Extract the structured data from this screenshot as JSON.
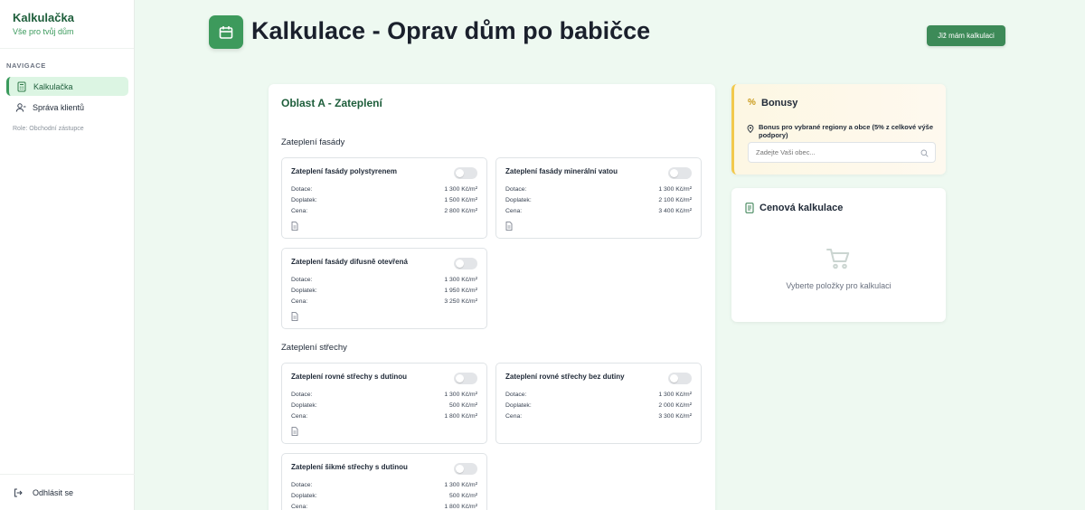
{
  "brand": {
    "title": "Kalkulačka",
    "subtitle": "Vše pro tvůj dům"
  },
  "nav": {
    "heading": "NAVIGACE",
    "items": [
      {
        "label": "Kalkulačka",
        "icon": "calculator-icon",
        "active": true
      },
      {
        "label": "Správa klientů",
        "icon": "user-icon",
        "active": false
      }
    ],
    "role": "Role: Obchodní zástupce",
    "logout": "Odhlásit se"
  },
  "header": {
    "title": "Kalkulace - Oprav dům po babičce",
    "icon": "calendar-icon",
    "button": "Již mám kalkulaci"
  },
  "area": {
    "title": "Oblast A - Zateplení",
    "sections": [
      {
        "title": "Zateplení fasády",
        "items": [
          {
            "name": "Zateplení fasády polystyrenem",
            "dotace": "1 300 Kč/m²",
            "doplatek": "1 500 Kč/m²",
            "cena": "2 800 Kč/m²"
          },
          {
            "name": "Zateplení fasády minerální vatou",
            "dotace": "1 300 Kč/m²",
            "doplatek": "2 100 Kč/m²",
            "cena": "3 400 Kč/m²"
          },
          {
            "name": "Zateplení fasády difusně otevřená",
            "dotace": "1 300 Kč/m²",
            "doplatek": "1 950 Kč/m²",
            "cena": "3 250 Kč/m²"
          }
        ]
      },
      {
        "title": "Zateplení střechy",
        "items": [
          {
            "name": "Zateplení rovné střechy s dutinou",
            "dotace": "1 300 Kč/m²",
            "doplatek": "500 Kč/m²",
            "cena": "1 800 Kč/m²"
          },
          {
            "name": "Zateplení rovné střechy bez dutiny",
            "dotace": "1 300 Kč/m²",
            "doplatek": "2 000 Kč/m²",
            "cena": "3 300 Kč/m²"
          },
          {
            "name": "Zateplení šikmé střechy s dutinou",
            "dotace": "1 300 Kč/m²",
            "doplatek": "500 Kč/m²",
            "cena": "1 800 Kč/m²"
          }
        ]
      }
    ],
    "labels": {
      "dotace": "Dotace:",
      "doplatek": "Doplatek:",
      "cena": "Cena:"
    }
  },
  "bonus": {
    "symbol": "%",
    "title": "Bonusy",
    "note": "Bonus pro vybrané regiony a obce (5% z celkové výše podpory)",
    "search_placeholder": "Zadejte Vaši obec...",
    "search_value": ""
  },
  "pricing": {
    "title": "Cenová kalkulace",
    "empty_text": "Vyberte položky pro kalkulaci"
  },
  "colors": {
    "accent": "#3d9a5c",
    "accent_dark": "#1e5e3b",
    "bonus_border": "#f2c94c"
  }
}
